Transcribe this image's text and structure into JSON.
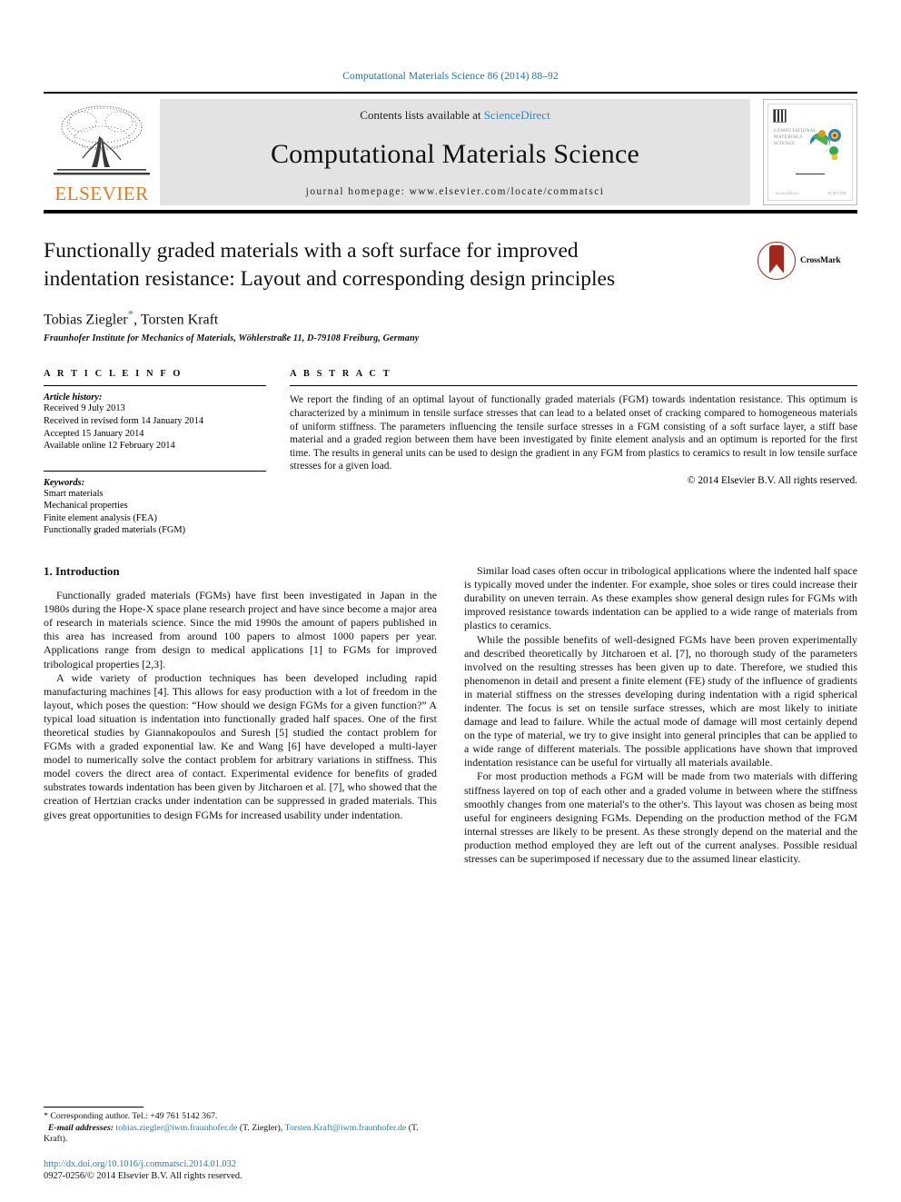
{
  "running_head": "Computational Materials Science 86 (2014) 88–92",
  "masthead": {
    "contents_prefix": "Contents lists available at ",
    "sciencedirect": "ScienceDirect",
    "journal_title": "Computational Materials Science",
    "homepage": "journal homepage: www.elsevier.com/locate/commatsci",
    "publisher_logo_text": "ELSEVIER",
    "cover_title_lines": "COMPUTATIONAL\nMATERIALS\nSCIENCE"
  },
  "title_block": {
    "title": "Functionally graded materials with a soft surface for improved indentation resistance: Layout and corresponding design principles",
    "author_1": "Tobias Ziegler",
    "corresponding_marker": "*",
    "author_rest": ", Torsten Kraft",
    "affiliation": "Fraunhofer Institute for Mechanics of Materials, Wöhlerstraße 11, D-79108 Freiburg, Germany",
    "crossmark_label": "CrossMark"
  },
  "article_info": {
    "heading": "A R T I C L E   I N F O",
    "history_label": "Article history:",
    "history": [
      "Received 9 July 2013",
      "Received in revised form 14 January 2014",
      "Accepted 15 January 2014",
      "Available online 12 February 2014"
    ],
    "keywords_label": "Keywords:",
    "keywords": [
      "Smart materials",
      "Mechanical properties",
      "Finite element analysis (FEA)",
      "Functionally graded materials (FGM)"
    ]
  },
  "abstract": {
    "heading": "A B S T R A C T",
    "text": "We report the finding of an optimal layout of functionally graded materials (FGM) towards indentation resistance. This optimum is characterized by a minimum in tensile surface stresses that can lead to a belated onset of cracking compared to homogeneous materials of uniform stiffness. The parameters influencing the tensile surface stresses in a FGM consisting of a soft surface layer, a stiff base material and a graded region between them have been investigated by finite element analysis and an optimum is reported for the first time. The results in general units can be used to design the gradient in any FGM from plastics to ceramics to result in low tensile surface stresses for a given load.",
    "copyright": "© 2014 Elsevier B.V. All rights reserved."
  },
  "body": {
    "section_heading": "1. Introduction",
    "left_paragraphs": [
      "Functionally graded materials (FGMs) have first been investigated in Japan in the 1980s during the Hope-X space plane research project and have since become a major area of research in materials science. Since the mid 1990s the amount of papers published in this area has increased from around 100 papers to almost 1000 papers per year. Applications range from design to medical applications [1] to FGMs for improved tribological properties [2,3].",
      "A wide variety of production techniques has been developed including rapid manufacturing machines [4]. This allows for easy production with a lot of freedom in the layout, which poses the question: “How should we design FGMs for a given function?” A typical load situation is indentation into functionally graded half spaces. One of the first theoretical studies by Giannakopoulos and Suresh [5] studied the contact problem for FGMs with a graded exponential law. Ke and Wang [6] have developed a multi-layer model to numerically solve the contact problem for arbitrary variations in stiffness. This model covers the direct area of contact. Experimental evidence for benefits of graded substrates towards indentation has been given by Jitcharoen et al. [7], who showed that the creation of Hertzian cracks under indentation can be suppressed in graded materials. This gives great opportunities to design FGMs for increased usability under indentation."
    ],
    "right_paragraphs": [
      "Similar load cases often occur in tribological applications where the indented half space is typically moved under the indenter. For example, shoe soles or tires could increase their durability on uneven terrain. As these examples show general design rules for FGMs with improved resistance towards indentation can be applied to a wide range of materials from plastics to ceramics.",
      "While the possible benefits of well-designed FGMs have been proven experimentally and described theoretically by Jitcharoen et al. [7], no thorough study of the parameters involved on the resulting stresses has been given up to date. Therefore, we studied this phenomenon in detail and present a finite element (FE) study of the influence of gradients in material stiffness on the stresses developing during indentation with a rigid spherical indenter. The focus is set on tensile surface stresses, which are most likely to initiate damage and lead to failure. While the actual mode of damage will most certainly depend on the type of material, we try to give insight into general principles that can be applied to a wide range of different materials. The possible applications have shown that improved indentation resistance can be useful for virtually all materials available.",
      "For most production methods a FGM will be made from two materials with differing stiffness layered on top of each other and a graded volume in between where the stiffness smoothly changes from one material's to the other's. This layout was chosen as being most useful for engineers designing FGMs. Depending on the production method of the FGM internal stresses are likely to be present. As these strongly depend on the material and the production method employed they are left out of the current analyses. Possible residual stresses can be superimposed if necessary due to the assumed linear elasticity."
    ]
  },
  "footnotes": {
    "corresponding": "* Corresponding author. Tel.: +49 761 5142 367.",
    "email_label": "E-mail addresses:",
    "email_1": "tobias.ziegler@iwm.fraunhofer.de",
    "email_1_owner": " (T. Ziegler), ",
    "email_2": "Torsten.Kraft@iwm.fraunhofer.de",
    "email_2_owner": " (T. Kraft)."
  },
  "doi_block": {
    "doi": "http://dx.doi.org/10.1016/j.commatsci.2014.01.032",
    "issn": "0927-0256/© 2014 Elsevier B.V. All rights reserved."
  },
  "colors": {
    "link": "#1f7bbf",
    "ref": "#2a89c8",
    "elsevier_orange": "#e87722",
    "masthead_gray": "#e3e3e3"
  }
}
